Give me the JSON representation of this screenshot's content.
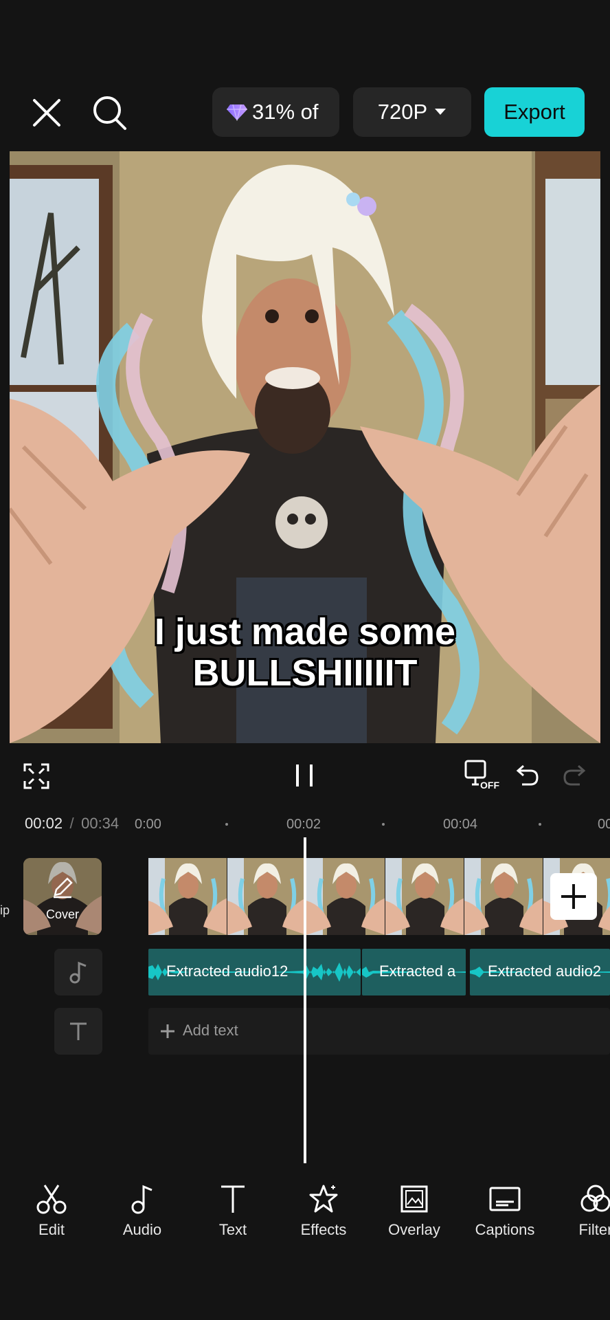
{
  "header": {
    "usage_text": "31% of",
    "resolution": "720P",
    "export_label": "Export"
  },
  "preview": {
    "caption_line1": "I just made some",
    "caption_line2": "BULLSHIIIIIT"
  },
  "playback": {
    "current_time": "00:02",
    "separator": "/",
    "total_time": "00:34",
    "loop_badge": "OFF"
  },
  "timeline": {
    "ruler_labels": [
      "0:00",
      "00:02",
      "00:04",
      "00"
    ],
    "side_label": "ip",
    "cover_label": "Cover",
    "audio_segments": [
      "Extracted audio12",
      "Extracted a",
      "Extracted audio2"
    ],
    "add_text_label": "Add text"
  },
  "toolbar": {
    "items": [
      "Edit",
      "Audio",
      "Text",
      "Effects",
      "Overlay",
      "Captions",
      "Filter"
    ]
  },
  "colors": {
    "accent": "#18d2d6",
    "audio_track": "#1e5f5f",
    "background": "#141414"
  }
}
